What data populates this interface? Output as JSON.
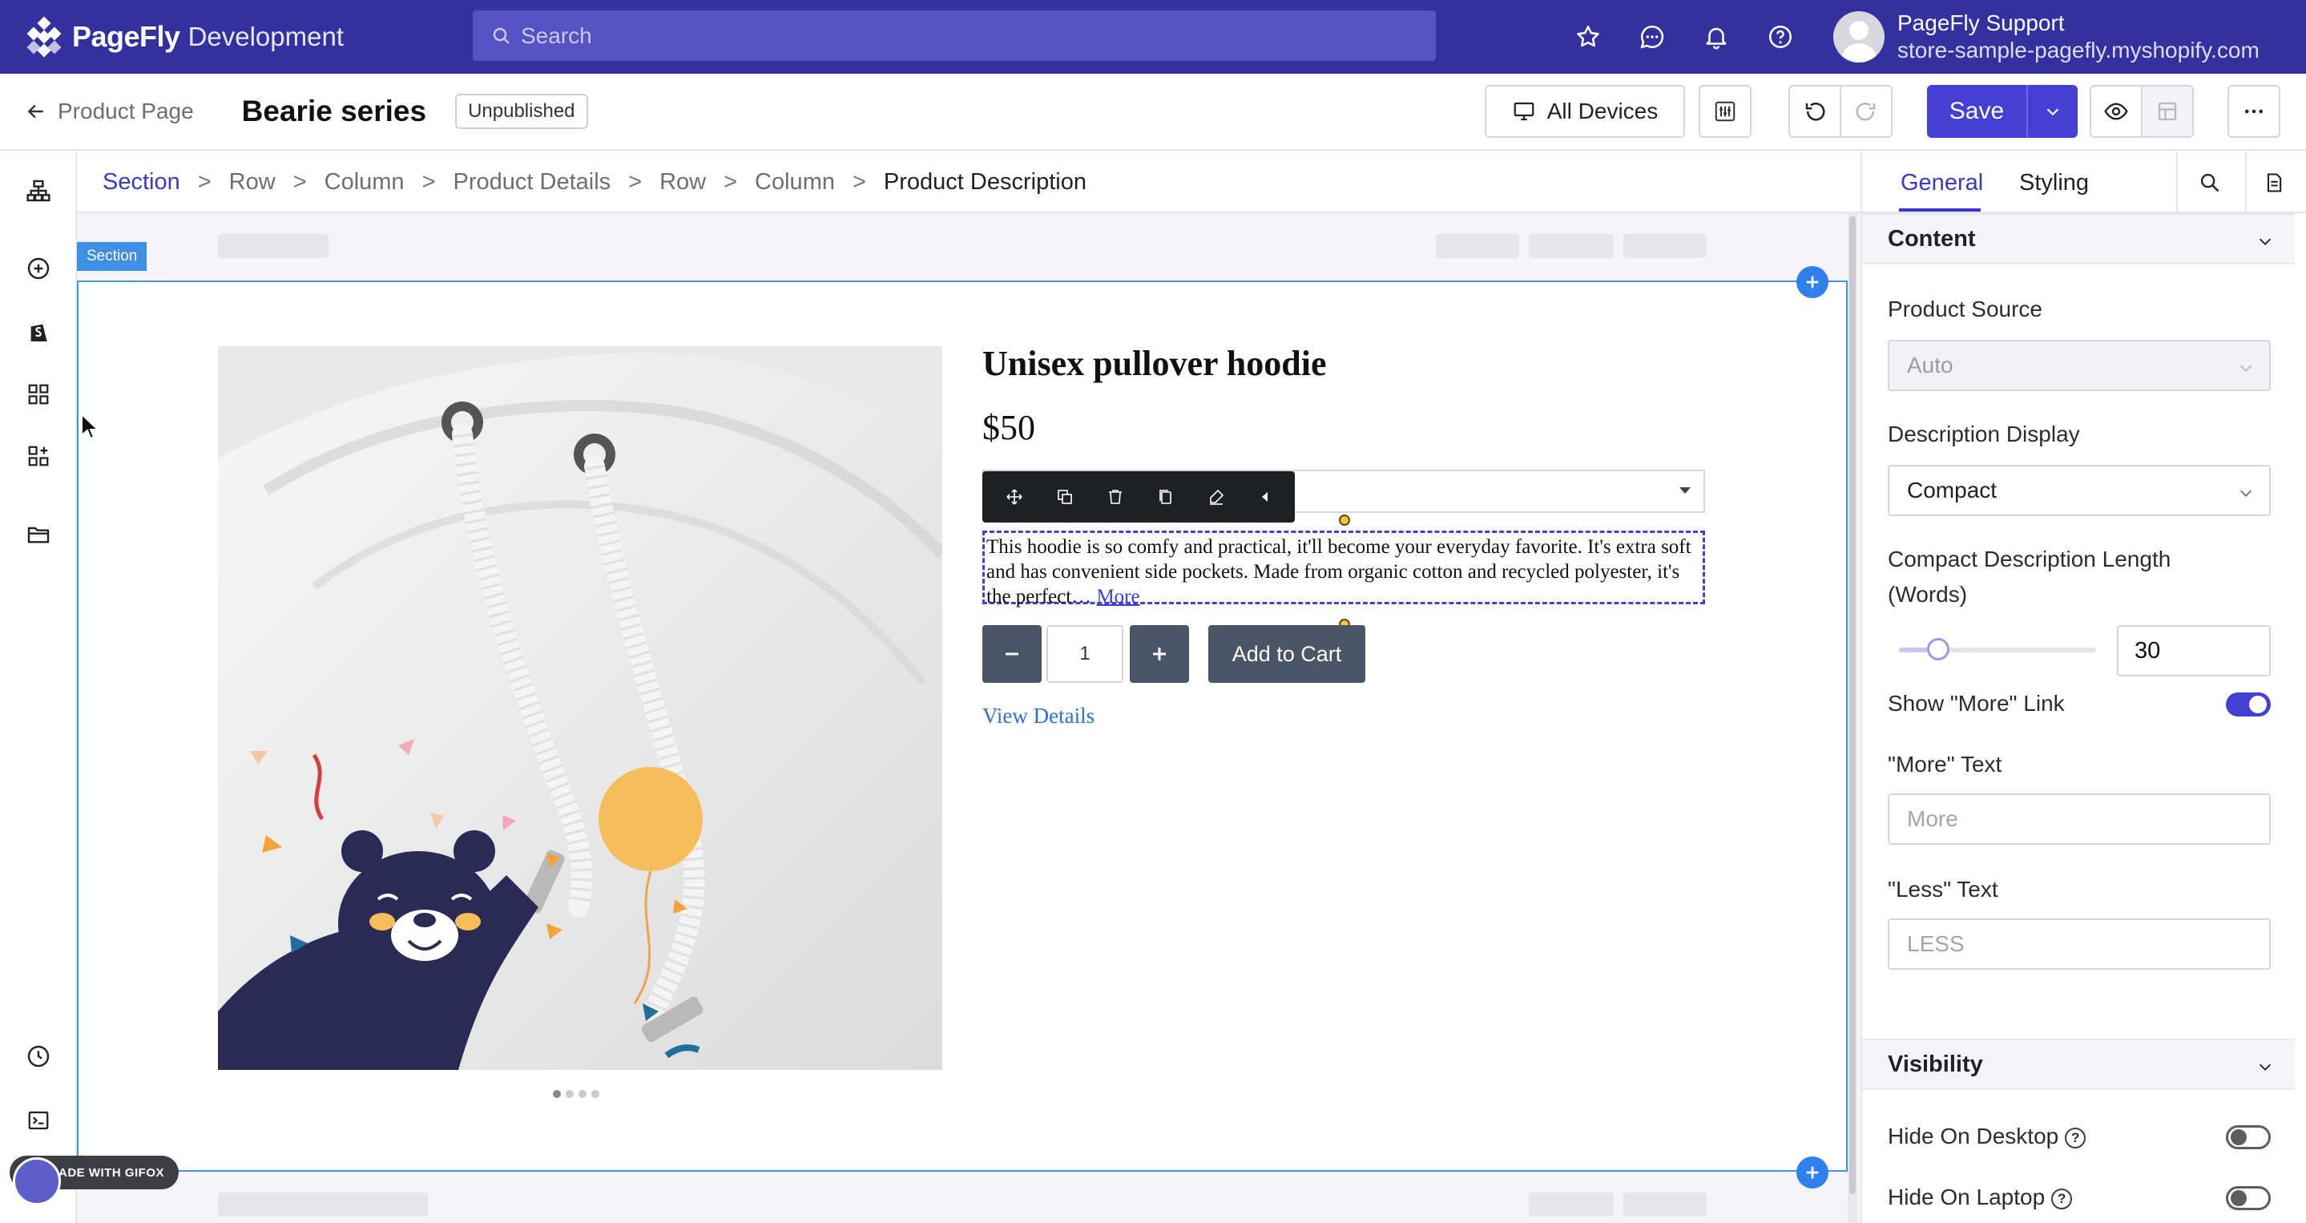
{
  "app": {
    "brand": "PageFly",
    "environment": "Development",
    "search_placeholder": "Search",
    "user_name": "PageFly Support",
    "user_store": "store-sample-pagefly.myshopify.com"
  },
  "toolbar": {
    "back_label": "Product Page",
    "page_title": "Bearie series",
    "status": "Unpublished",
    "devices_label": "All Devices",
    "save_label": "Save"
  },
  "breadcrumb": [
    "Section",
    "Row",
    "Column",
    "Product Details",
    "Row",
    "Column",
    "Product Description"
  ],
  "canvas": {
    "section_tag": "Section",
    "product_title": "Unisex pullover hoodie",
    "price": "$50",
    "description": "This hoodie is so comfy and practical, it'll become your everyday favorite. It's extra soft and has convenient side pockets. Made from organic cotton and recycled polyester, it's the perfect…",
    "more_link": "More",
    "quantity": "1",
    "add_to_cart": "Add to Cart",
    "view_details": "View Details",
    "qty_minus": "−",
    "qty_plus": "+"
  },
  "panel": {
    "tabs": [
      "General",
      "Styling"
    ],
    "content_header": "Content",
    "product_source_label": "Product Source",
    "product_source_value": "Auto",
    "description_display_label": "Description Display",
    "description_display_value": "Compact",
    "compact_length_label": "Compact Description Length (Words)",
    "compact_length_value": "30",
    "compact_length_slider_fraction": 0.2,
    "show_more_label": "Show \"More\" Link",
    "show_more_on": true,
    "more_text_label": "\"More\" Text",
    "more_text_placeholder": "More",
    "less_text_label": "\"Less\" Text",
    "less_text_placeholder": "LESS",
    "visibility_header": "Visibility",
    "hide_desktop_label": "Hide On Desktop",
    "hide_laptop_label": "Hide On Laptop"
  },
  "watermark": "MADE WITH GIFOX",
  "colors": {
    "topbar": "#3331a0",
    "accent": "#4440d6",
    "section_outline": "#4a90e2",
    "button_dark": "#4a5568"
  }
}
